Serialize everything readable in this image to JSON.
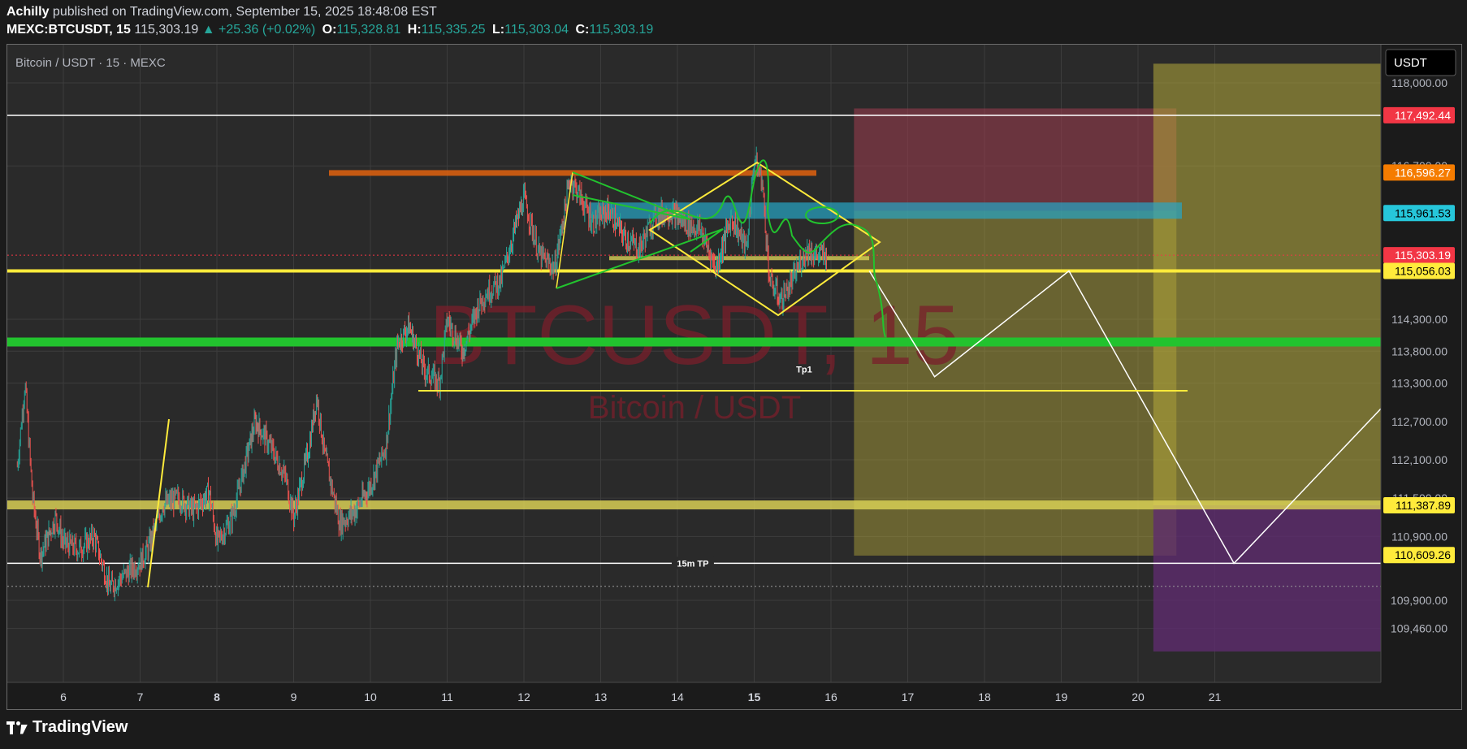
{
  "header": {
    "author": "Achilly",
    "published_text": "published on TradingView.com, September 15, 2025 18:48:08 EST",
    "symbol": "MEXC:BTCUSDT, 15",
    "last": "115,303.19",
    "change_arrow": "▲",
    "change": "+25.36 (+0.02%)",
    "o_label": "O:",
    "o_value": "115,328.81",
    "h_label": "H:",
    "h_value": "115,335.25",
    "l_label": "L:",
    "l_value": "115,303.04",
    "c_label": "C:",
    "c_value": "115,303.19"
  },
  "chart_title": "Bitcoin / USDT · 15 · MEXC",
  "currency_button": "USDT",
  "watermark": {
    "symbol": "BTCUSDT, 15",
    "name": "Bitcoin / USDT"
  },
  "footer": {
    "brand": "TradingView",
    "icon": "tradingview-logo-icon"
  },
  "colors": {
    "background": "#1b1b1b",
    "up": "#26a69a",
    "down": "#ef5350",
    "yellow": "#ffeb3b",
    "green_zone": "#22c32e",
    "red_label": "#f23645",
    "orange_label": "#f57c00",
    "cyan_label": "#26c6da",
    "target_zone": "#b5a93a",
    "stop_zone": "#8d3a4a",
    "purple_zone": "#5e2c6e"
  },
  "chart_data": {
    "type": "candlestick",
    "title": "Bitcoin / USDT · 15 · MEXC",
    "x_axis": {
      "ticks": [
        "6",
        "7",
        "8",
        "9",
        "10",
        "11",
        "12",
        "13",
        "14",
        "15",
        "16",
        "17",
        "18",
        "19",
        "20",
        "21"
      ],
      "bold_ticks": [
        "8",
        "15"
      ]
    },
    "y_axis": {
      "ticks": [
        "118,000.00",
        "116,700.00",
        "114,300.00",
        "113,800.00",
        "113,300.00",
        "112,700.00",
        "112,100.00",
        "111,500.00",
        "110,900.00",
        "109,900.00",
        "109,460.00"
      ],
      "ylim": [
        109100,
        118300
      ]
    },
    "price_series": {
      "name": "BTCUSDT",
      "day": [
        5.4,
        5.5,
        5.6,
        5.7,
        5.8,
        5.9,
        6.0,
        6.2,
        6.4,
        6.6,
        6.8,
        7.0,
        7.1,
        7.3,
        7.5,
        7.7,
        7.9,
        8.0,
        8.2,
        8.4,
        8.5,
        8.7,
        8.9,
        9.0,
        9.2,
        9.3,
        9.4,
        9.6,
        9.8,
        10.0,
        10.2,
        10.35,
        10.5,
        10.7,
        10.9,
        11.0,
        11.2,
        11.4,
        11.5,
        11.7,
        11.9,
        12.0,
        12.2,
        12.4,
        12.6,
        12.7,
        12.9,
        13.1,
        13.3,
        13.5,
        13.7,
        13.9,
        14.1,
        14.3,
        14.5,
        14.7,
        14.9,
        15.0,
        15.1,
        15.2,
        15.35,
        15.5,
        15.6,
        15.7,
        15.8,
        15.95
      ],
      "close": [
        112000,
        113300,
        111500,
        110600,
        110900,
        111200,
        110800,
        110700,
        110900,
        110100,
        110300,
        110500,
        110700,
        111400,
        111500,
        111300,
        111600,
        110800,
        111200,
        112200,
        112700,
        112300,
        111800,
        111200,
        112300,
        113100,
        112200,
        111100,
        111300,
        111700,
        112300,
        113900,
        114200,
        113500,
        113300,
        114300,
        113800,
        114500,
        114700,
        114900,
        115800,
        116200,
        115300,
        115100,
        116500,
        116300,
        115800,
        116000,
        115600,
        115400,
        115900,
        116000,
        115800,
        115700,
        115100,
        115900,
        115400,
        116800,
        116500,
        114900,
        114600,
        114900,
        115200,
        115400,
        115300,
        115303
      ]
    },
    "horizontal_levels": [
      {
        "price": 117492.44,
        "label": "117,492.44",
        "label_color": "#f23645"
      },
      {
        "price": 116596.27,
        "label": "116,596.27",
        "label_color": "#f57c00"
      },
      {
        "price": 115961.53,
        "label": "115,961.53",
        "label_color": "#26c6da"
      },
      {
        "price": 115303.19,
        "label": "115,303.19",
        "label_color": "#f23645"
      },
      {
        "price": 115056.03,
        "label": "115,056.03",
        "label_color": "#ffeb3b"
      },
      {
        "price": 111387.89,
        "label": "111,387.89",
        "label_color": "#ffeb3b"
      },
      {
        "price": 110609.26,
        "label": "110,609.26",
        "label_color": "#ffeb3b"
      }
    ],
    "annotations": [
      {
        "text": "Tp1",
        "day": 15.65,
        "price": 113520
      },
      {
        "text": "15m TP",
        "day": 14.2,
        "price": 110480
      }
    ],
    "projection_path": {
      "day": [
        16.5,
        17.35,
        19.1,
        21.25,
        23.2
      ],
      "price": [
        115056,
        113400,
        115056,
        110480,
        112900
      ]
    },
    "zones": [
      {
        "name": "short-target",
        "day_from": 16.3,
        "day_to": 20.5,
        "price_from": 110600,
        "price_to": 116000
      },
      {
        "name": "short-stop",
        "day_from": 16.3,
        "day_to": 20.5,
        "price_from": 116000,
        "price_to": 117600
      },
      {
        "name": "long-target",
        "day_from": 20.2,
        "day_to": 23.2,
        "price_from": 111387,
        "price_to": 118300
      },
      {
        "name": "long-stop",
        "day_from": 20.2,
        "day_to": 23.2,
        "price_from": 109100,
        "price_to": 111387
      }
    ]
  }
}
